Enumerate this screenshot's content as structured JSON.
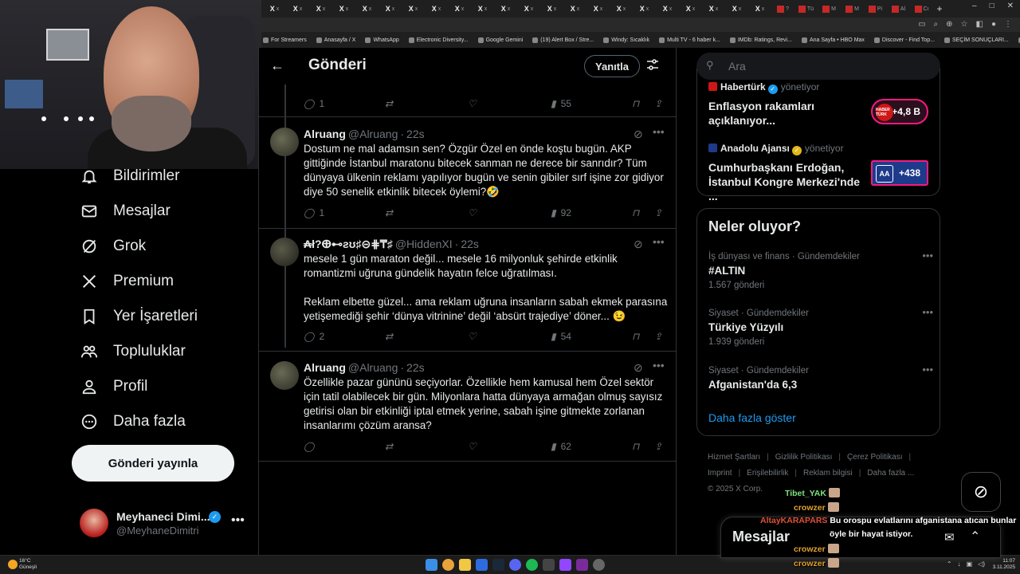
{
  "browser": {
    "tabs": [
      {
        "icon": "X",
        "label": "x"
      },
      {
        "icon": "X",
        "label": "x"
      },
      {
        "icon": "X",
        "label": "x"
      },
      {
        "icon": "X",
        "label": "x"
      },
      {
        "icon": "X",
        "label": "x"
      },
      {
        "icon": "X",
        "label": "x"
      },
      {
        "icon": "X",
        "label": "x"
      },
      {
        "icon": "X",
        "label": "x"
      },
      {
        "icon": "X",
        "label": "x"
      },
      {
        "icon": "X",
        "label": "x"
      },
      {
        "icon": "X",
        "label": "x"
      },
      {
        "icon": "X",
        "label": "x"
      },
      {
        "icon": "X",
        "label": "x"
      },
      {
        "icon": "X",
        "label": "x"
      },
      {
        "icon": "X",
        "label": "x"
      },
      {
        "icon": "X",
        "label": "x"
      },
      {
        "icon": "X",
        "label": "x"
      },
      {
        "icon": "X",
        "label": "x"
      },
      {
        "icon": "X",
        "label": "x"
      },
      {
        "icon": "X",
        "label": "x"
      },
      {
        "icon": "X",
        "label": "x"
      },
      {
        "icon": "X",
        "label": "x"
      },
      {
        "icon": "red",
        "label": "?"
      },
      {
        "icon": "red",
        "label": "Tü"
      },
      {
        "icon": "red",
        "label": "M"
      },
      {
        "icon": "red",
        "label": "M"
      },
      {
        "icon": "red",
        "label": "Pi"
      },
      {
        "icon": "red",
        "label": "Al"
      },
      {
        "icon": "red",
        "label": "Cı"
      }
    ],
    "new_tab": "+",
    "bookmarks": [
      "For Streamers",
      "Anasayfa / X",
      "WhatsApp",
      "Electronic Diversity...",
      "Google Gemini",
      "(19) Alert Box / Stre...",
      "Windy: Sıcaklık",
      "Multi TV - 6 haber k...",
      "IMDb: Ratings, Revi...",
      "Ana Sayfa • HBO Max",
      "Discover - Find Top...",
      "SEÇİM SONUÇLARI...",
      "ChatGPT",
      "»",
      "Tüm Yer İşaretleri"
    ]
  },
  "nav": {
    "items": [
      {
        "label": "Bildirimler",
        "icon": "bell-icon"
      },
      {
        "label": "Mesajlar",
        "icon": "mail-icon"
      },
      {
        "label": "Grok",
        "icon": "grok-icon"
      },
      {
        "label": "Premium",
        "icon": "x-logo-icon"
      },
      {
        "label": "Yer İşaretleri",
        "icon": "bookmark-icon"
      },
      {
        "label": "Topluluklar",
        "icon": "communities-icon"
      },
      {
        "label": "Profil",
        "icon": "person-icon"
      },
      {
        "label": "Daha fazla",
        "icon": "more-circle-icon"
      }
    ],
    "post_button": "Gönderi yayınla",
    "account": {
      "name": "Meyhaneci Dimi...",
      "handle": "@MeyhaneDimitri",
      "more": "•••"
    }
  },
  "main": {
    "title": "Gönderi",
    "back": "←",
    "reply_button": "Yanıtla",
    "tweets": [
      {
        "name": "Alruang",
        "handle": "@Alruang",
        "time": "22s",
        "text": "Dostum ne mal adamsın sen? Özgür Özel en önde koştu bugün. AKP gittiğinde İstanbul maratonu bitecek sanman ne derece bir sanrıdır? Tüm dünyaya ülkenin reklamı yapılıyor bugün ve senin gibiler sırf işine zor gidiyor diye 50 senelik etkinlik bitecek öylemi?🤣",
        "replies": "1",
        "views": "92"
      },
      {
        "name": "₳ł?ⴲ⊷ƨʊ♯⊝⋕₸♯",
        "handle": "@HiddenXI",
        "time": "22s",
        "text": "mesele 1 gün maraton değil... mesele 16 milyonluk şehirde etkinlik romantizmi uğruna gündelik hayatın felce uğratılması.\n\nReklam elbette güzel... ama reklam uğruna insanların sabah ekmek parasına yetişemediği şehir ‘dünya vitrinine’ değil ‘absürt trajediye’ döner... 😉",
        "replies": "2",
        "views": "54"
      },
      {
        "name": "Alruang",
        "handle": "@Alruang",
        "time": "22s",
        "text": "Özellikle pazar gününü seçiyorlar. Özellikle hem kamusal hem Özel sektör için tatil olabilecek bir gün. Milyonlara hatta dünyaya armağan olmuş sayısız getirisi olan bir etkinliği iptal etmek yerine, sabah işine gitmekte zorlanan insanlarımı çözüm aransa?",
        "replies": "",
        "views": "62"
      }
    ],
    "prev_actions": {
      "replies": "1",
      "views": "55"
    }
  },
  "right": {
    "search_placeholder": "Ara",
    "live": [
      {
        "source": "Habertürk",
        "verb": "yönetiyor",
        "title": "Enflasyon rakamları açıklanıyor...",
        "count": "+4,8 B",
        "logo": "HABER TÜRK",
        "icon_color": "#d01616",
        "verified_color": "#1d9bf0"
      },
      {
        "source": "Anadolu Ajansı",
        "verb": "yönetiyor",
        "title": "Cumhurbaşkanı Erdoğan, İstanbul Kongre Merkezi'nde ...",
        "count": "+438",
        "logo": "AA",
        "icon_color": "#1e3a8a",
        "verified_color": "#e2b719"
      }
    ],
    "trends_title": "Neler oluyor?",
    "trends": [
      {
        "context": "İş dünyası ve finans · Gündemdekiler",
        "title": "#ALTIN",
        "count": "1.567 gönderi"
      },
      {
        "context": "Siyaset · Gündemdekiler",
        "title": "Türkiye Yüzyılı",
        "count": "1.939 gönderi"
      },
      {
        "context": "Siyaset · Gündemdekiler",
        "title": "Afganistan'da 6,3",
        "count": ""
      }
    ],
    "show_more": "Daha fazla göster",
    "footer": [
      "Hizmet Şartları",
      "Gizlilik Politikası",
      "Çerez Politikası",
      "Imprint",
      "Erişilebilirlik",
      "Reklam bilgisi",
      "Daha fazla ...",
      "© 2025 X Corp."
    ]
  },
  "drawer": {
    "title": "Mesajlar"
  },
  "chat": [
    {
      "user": "Tibet_YAK",
      "color": "#7ee07e",
      "message": ""
    },
    {
      "user": "crowzer",
      "color": "#e0a030",
      "message": ""
    },
    {
      "user": "AltayKARAPARS",
      "color": "#e0503a",
      "message": "Bu orospu evlatlarını afganistana atıcan bunlar"
    },
    {
      "user": "",
      "color": "#ffffff",
      "message": "öyle bir hayat istiyor."
    },
    {
      "user": "crowzer",
      "color": "#e0a030",
      "message": ""
    },
    {
      "user": "crowzer",
      "color": "#e0a030",
      "message": ""
    }
  ],
  "taskbar": {
    "weather_temp": "16°C",
    "weather_desc": "Güneşli",
    "time": "11:07",
    "date": "3.11.2025"
  },
  "colors": {
    "accent": "#1d9bf0",
    "live_pink": "#f91880",
    "bg": "#000000",
    "muted": "#71767b"
  }
}
